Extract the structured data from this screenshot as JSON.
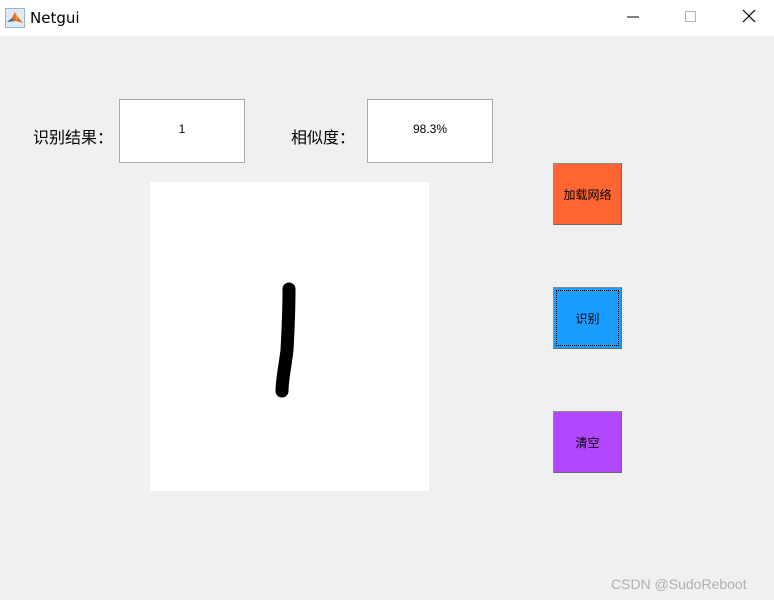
{
  "window": {
    "title": "Netgui",
    "icon": "matlab-icon",
    "controls": [
      "minimize-icon",
      "maximize-icon",
      "close-icon"
    ]
  },
  "result": {
    "label": "识别结果：",
    "value": "1"
  },
  "similarity": {
    "label": "相似度：",
    "value": "98.3%"
  },
  "drawing_canvas": {
    "background": "#ffffff",
    "stroke_color": "#000000",
    "drawn_digit": "1"
  },
  "buttons": {
    "load_network": {
      "label": "加载网络",
      "color": "#ff6633"
    },
    "recognize": {
      "label": "识别",
      "color": "#1a9dff"
    },
    "clear": {
      "label": "清空",
      "color": "#b347ff"
    }
  },
  "watermark": "CSDN @SudoReboot"
}
